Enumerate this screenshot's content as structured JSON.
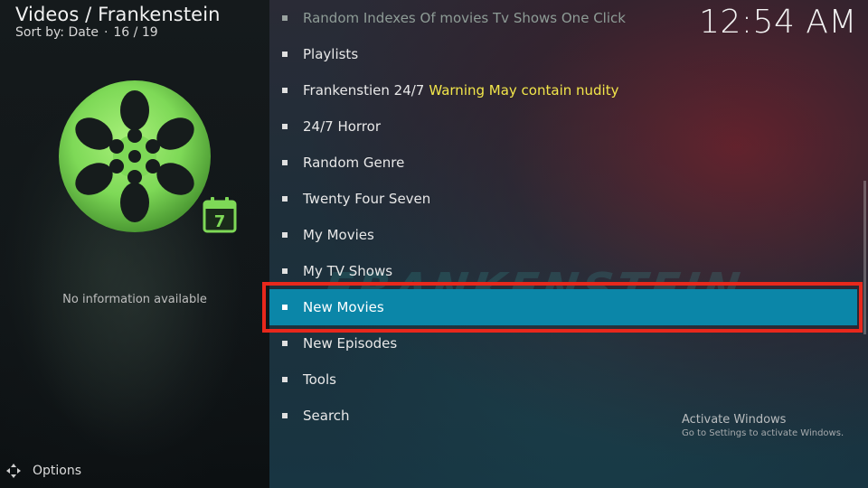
{
  "header": {
    "title": "Videos / Frankenstein",
    "sort_label": "Sort by: Date",
    "separator": "·",
    "position": "16 / 19"
  },
  "clock": "12:54 AM",
  "left": {
    "no_info": "No information available",
    "calendar_number": "7",
    "options_label": "Options"
  },
  "menu": {
    "items": [
      {
        "label": "Random Indexes Of movies Tv Shows One Click",
        "warning": ""
      },
      {
        "label": "Playlists",
        "warning": ""
      },
      {
        "label": "Frankenstien 24/7",
        "warning": "Warning May contain nudity"
      },
      {
        "label": "24/7 Horror",
        "warning": ""
      },
      {
        "label": "Random Genre",
        "warning": ""
      },
      {
        "label": "Twenty Four Seven",
        "warning": ""
      },
      {
        "label": "My Movies",
        "warning": ""
      },
      {
        "label": "My TV Shows",
        "warning": ""
      },
      {
        "label": "New Movies",
        "warning": ""
      },
      {
        "label": "New Episodes",
        "warning": ""
      },
      {
        "label": "Tools",
        "warning": ""
      },
      {
        "label": "Search",
        "warning": ""
      }
    ],
    "selected_index": 8
  },
  "watermark": "FRANKENSTEIN",
  "activate_windows": {
    "title": "Activate Windows",
    "subtitle": "Go to Settings to activate Windows."
  },
  "colors": {
    "selection": "#0b86a8",
    "highlight_border": "#e8281c",
    "warning_text": "#f2e64a",
    "reel_green": "#7ed957"
  },
  "icons": {
    "reel": "film-reel-icon",
    "calendar": "calendar-icon",
    "options": "options-icon"
  }
}
